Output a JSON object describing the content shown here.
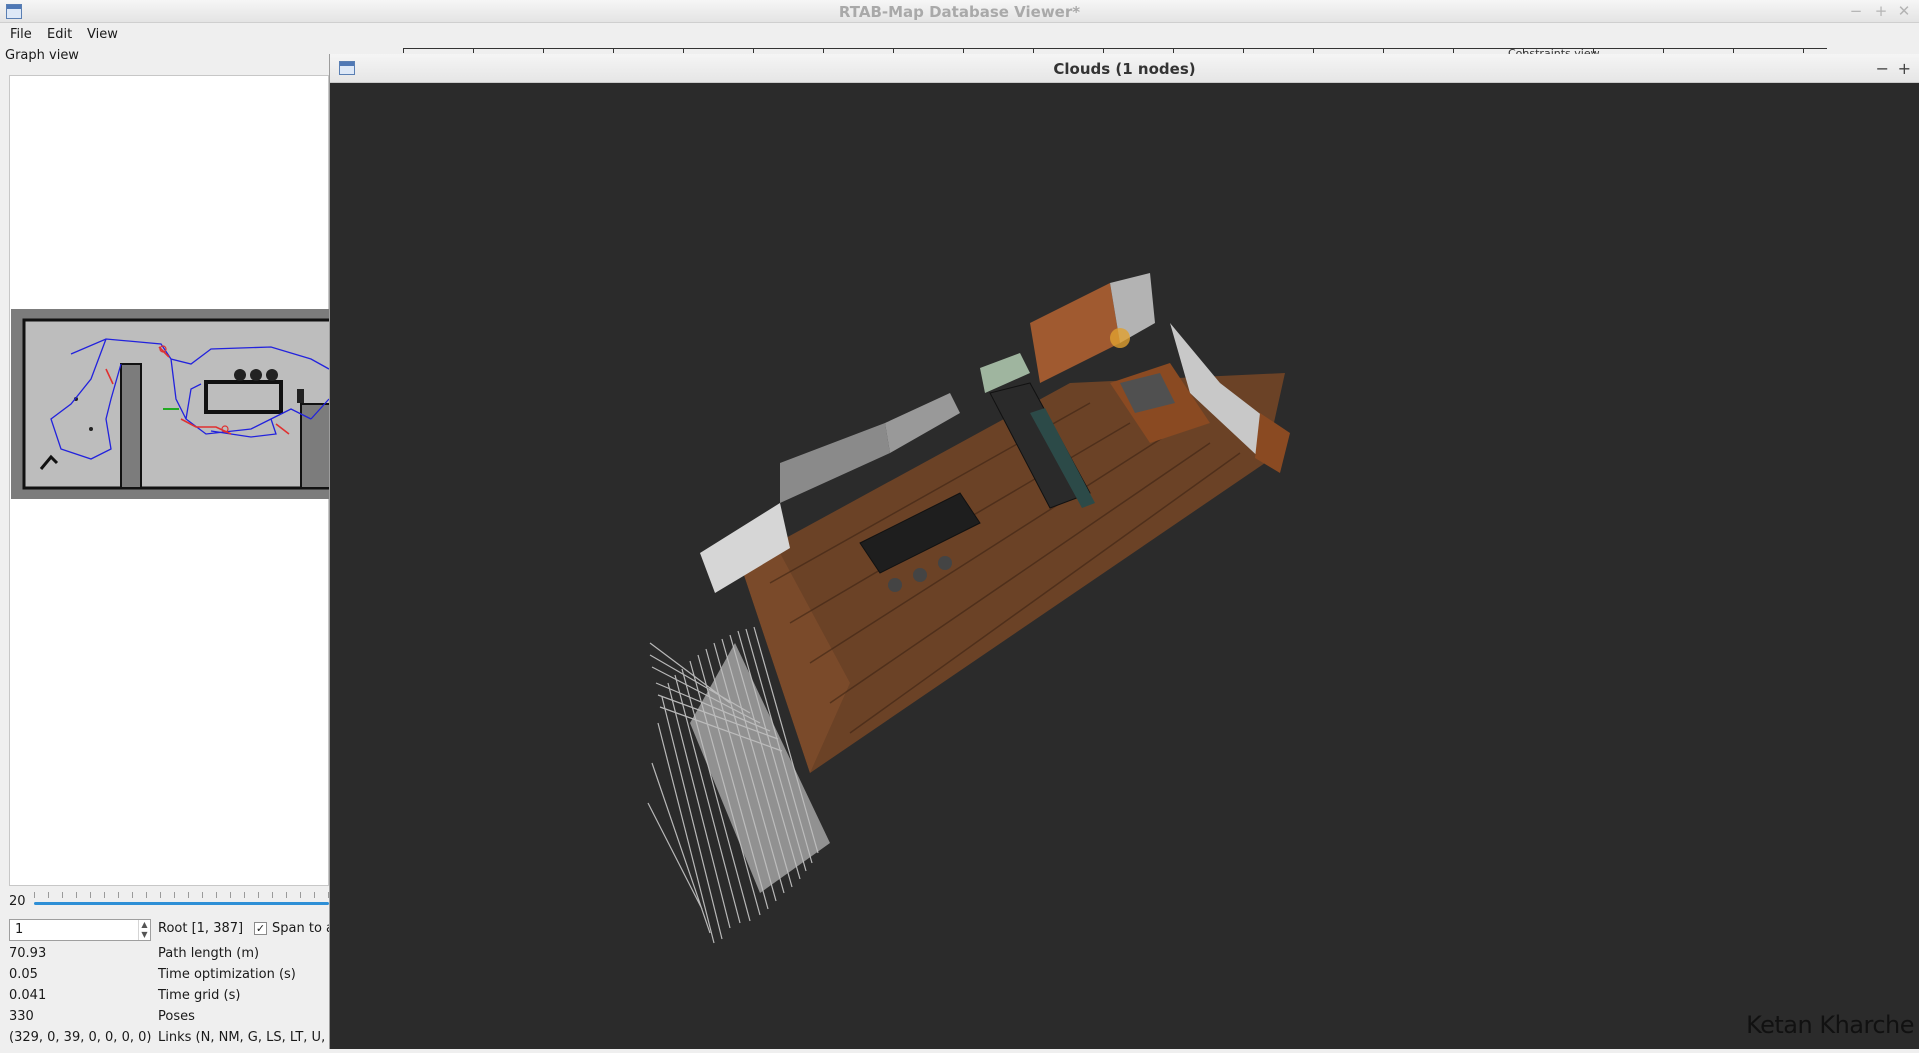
{
  "window": {
    "title": "RTAB-Map Database Viewer*",
    "controls": {
      "minimize": "−",
      "maximize": "+",
      "close": "✕"
    }
  },
  "menu": {
    "file": "File",
    "edit": "Edit",
    "view": "View"
  },
  "graph_view": {
    "title": "Graph view",
    "slider_value": "20",
    "spin_value": "1",
    "root_label": "Root [1, 387]",
    "span_label": "Span to a",
    "span_checked": true,
    "stats": [
      {
        "value": "70.93",
        "label": "Path length (m)"
      },
      {
        "value": "0.05",
        "label": "Time optimization (s)"
      },
      {
        "value": "0.041",
        "label": "Time grid (s)"
      },
      {
        "value": "330",
        "label": "Poses"
      },
      {
        "value": "(329, 0, 39, 0, 0, 0, 0)",
        "label": "Links (N, NM, G, LS, LT, U,"
      }
    ]
  },
  "constraints_view": {
    "title": "Constraints view"
  },
  "clouds_window": {
    "title": "Clouds (1 nodes)",
    "controls": {
      "minimize": "−",
      "maximize": "+"
    },
    "watermark": "Ketan Kharche"
  },
  "colors": {
    "viewport_bg": "#2b2b2b",
    "floor": "#6b4226",
    "path_blue": "#2222dd",
    "loop_red": "#e03030",
    "slider_blue": "#2e8fd6"
  }
}
